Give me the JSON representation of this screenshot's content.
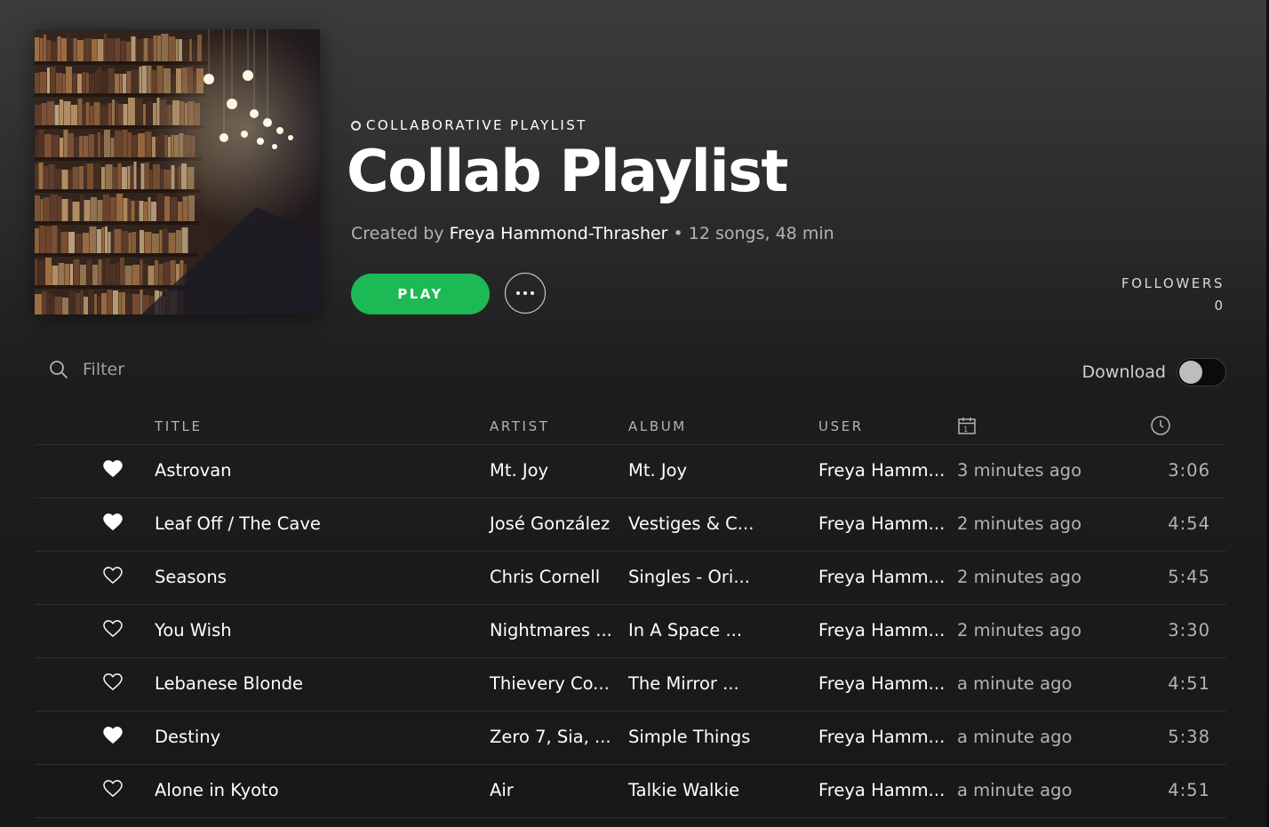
{
  "header": {
    "cover_alt": "library-bookshelves-cover",
    "type_label": "COLLABORATIVE PLAYLIST",
    "title": "Collab Playlist",
    "created_by_label": "Created by",
    "owner": "Freya Hammond-Thrasher",
    "stats": "• 12 songs, 48 min",
    "play_label": "PLAY",
    "more_icon": "ellipsis-icon",
    "followers_label": "FOLLOWERS",
    "followers_count": "0"
  },
  "toolbar": {
    "filter_placeholder": "Filter",
    "search_icon": "search-icon",
    "download_label": "Download",
    "download_enabled": false
  },
  "columns": {
    "title": "TITLE",
    "artist": "ARTIST",
    "album": "ALBUM",
    "user": "USER",
    "added_icon": "calendar-icon",
    "duration_icon": "clock-icon"
  },
  "colors": {
    "accent": "#1db954",
    "text_muted": "#b3b3b3"
  },
  "tracks": [
    {
      "liked": true,
      "title": "Astrovan",
      "artist": "Mt. Joy",
      "album": "Mt. Joy",
      "user": "Freya Hamm...",
      "added": "3 minutes ago",
      "duration": "3:06"
    },
    {
      "liked": true,
      "title": "Leaf Off / The Cave",
      "artist": "José González",
      "album": "Vestiges & C...",
      "user": "Freya Hamm...",
      "added": "2 minutes ago",
      "duration": "4:54"
    },
    {
      "liked": false,
      "title": "Seasons",
      "artist": "Chris Cornell",
      "album": "Singles - Ori...",
      "user": "Freya Hamm...",
      "added": "2 minutes ago",
      "duration": "5:45"
    },
    {
      "liked": false,
      "title": "You Wish",
      "artist": "Nightmares ...",
      "album": "In A Space ...",
      "user": "Freya Hamm...",
      "added": "2 minutes ago",
      "duration": "3:30"
    },
    {
      "liked": false,
      "title": "Lebanese Blonde",
      "artist": "Thievery Co...",
      "album": "The Mirror ...",
      "user": "Freya Hamm...",
      "added": "a minute ago",
      "duration": "4:51"
    },
    {
      "liked": true,
      "title": "Destiny",
      "artist": "Zero 7, Sia, ...",
      "album": "Simple Things",
      "user": "Freya Hamm...",
      "added": "a minute ago",
      "duration": "5:38"
    },
    {
      "liked": false,
      "title": "Alone in Kyoto",
      "artist": "Air",
      "album": "Talkie Walkie",
      "user": "Freya Hamm...",
      "added": "a minute ago",
      "duration": "4:51"
    }
  ]
}
